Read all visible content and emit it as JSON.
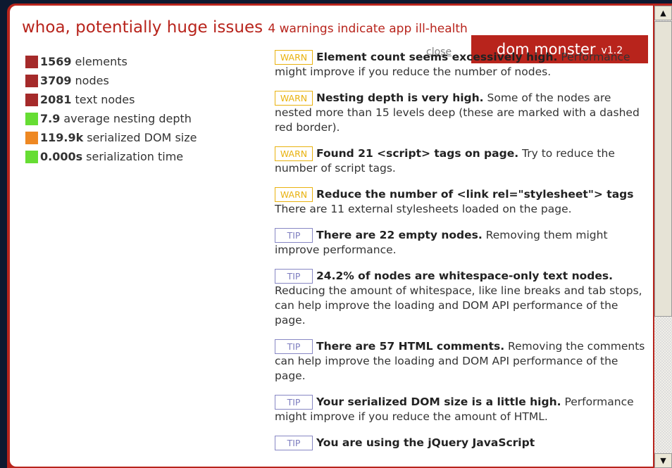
{
  "header": {
    "title": "whoa, potentially huge issues",
    "subtitle": "4 warnings indicate app ill-health"
  },
  "stats": [
    {
      "value": "1569",
      "label": "elements",
      "color": "#a52a2a"
    },
    {
      "value": "3709",
      "label": "nodes",
      "color": "#a52a2a"
    },
    {
      "value": "2081",
      "label": "text nodes",
      "color": "#a52a2a"
    },
    {
      "value": "7.9",
      "label": "average nesting depth",
      "color": "#66dd33"
    },
    {
      "value": "119.9k",
      "label": "serialized DOM size",
      "color": "#ee8822"
    },
    {
      "value": "0.000s",
      "label": "serialization time",
      "color": "#66dd33"
    }
  ],
  "close_label": "close",
  "brand": {
    "name": "dom monster",
    "version": "v1.2"
  },
  "messages": [
    {
      "tag": "WARN",
      "bold": "Element count seems excessively high.",
      "text": "Performance might improve if you reduce the number of nodes."
    },
    {
      "tag": "WARN",
      "bold": "Nesting depth is very high.",
      "text": "Some of the nodes are nested more than 15 levels deep (these are marked with a dashed red border)."
    },
    {
      "tag": "WARN",
      "bold": "Found 21 <script> tags on page.",
      "text": "Try to reduce the number of script tags."
    },
    {
      "tag": "WARN",
      "bold": "Reduce the number of <link rel=\"stylesheet\"> tags",
      "text": "There are 11 external stylesheets loaded on the page."
    },
    {
      "tag": "TIP",
      "bold": "There are 22 empty nodes.",
      "text": "Removing them might improve performance."
    },
    {
      "tag": "TIP",
      "bold": "24.2% of nodes are whitespace-only text nodes.",
      "text": "Reducing the amount of whitespace, like line breaks and tab stops, can help improve the loading and DOM API performance of the page."
    },
    {
      "tag": "TIP",
      "bold": "There are 57 HTML comments.",
      "text": "Removing the comments can help improve the loading and DOM API performance of the page."
    },
    {
      "tag": "TIP",
      "bold": "Your serialized DOM size is a little high.",
      "text": "Performance might improve if you reduce the amount of HTML."
    },
    {
      "tag": "TIP",
      "bold": "You are using the jQuery JavaScript",
      "text": ""
    }
  ]
}
